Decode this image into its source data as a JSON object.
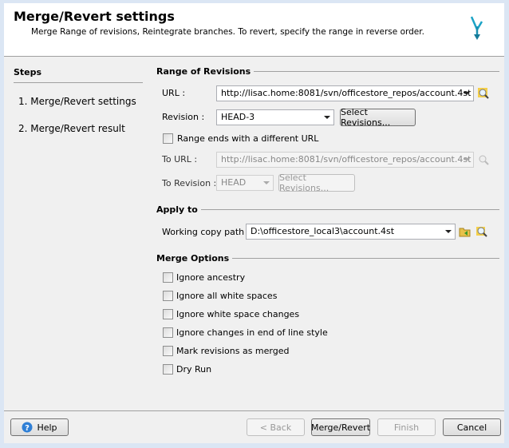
{
  "header": {
    "title": "Merge/Revert settings",
    "subtitle": "Merge Range of revisions, Reintegrate branches. To revert, specify the range in reverse order.",
    "logo_icon": "arrow-merge-icon"
  },
  "steps": {
    "title": "Steps",
    "items": [
      "1. Merge/Revert settings",
      "2. Merge/Revert result"
    ]
  },
  "range": {
    "title": "Range of Revisions",
    "url_label": "URL :",
    "url_value": "http://lisac.home:8081/svn/officestore_repos/account.4st",
    "revision_label": "Revision :",
    "revision_value": "HEAD-3",
    "select_revisions": "Select Revisions...",
    "range_checkbox": "Range ends with a different URL",
    "range_checked": false,
    "to_url_label": "To URL :",
    "to_url_value": "http://lisac.home:8081/svn/officestore_repos/account.4st",
    "to_revision_label": "To Revision :",
    "to_revision_value": "HEAD",
    "to_select_revisions": "Select Revisions..."
  },
  "apply": {
    "title": "Apply to",
    "wc_label": "Working copy path :",
    "wc_value": "D:\\officestore_local3\\account.4st"
  },
  "options": {
    "title": "Merge Options",
    "items": [
      {
        "label": "Ignore ancestry",
        "checked": false
      },
      {
        "label": "Ignore all white spaces",
        "checked": false
      },
      {
        "label": "Ignore white space changes",
        "checked": false
      },
      {
        "label": "Ignore changes in end of line style",
        "checked": false
      },
      {
        "label": "Mark revisions as merged",
        "checked": false
      },
      {
        "label": "Dry Run",
        "checked": false
      }
    ]
  },
  "footer": {
    "help": "Help",
    "back": "< Back",
    "merge": "Merge/Revert",
    "finish": "Finish",
    "cancel": "Cancel"
  }
}
